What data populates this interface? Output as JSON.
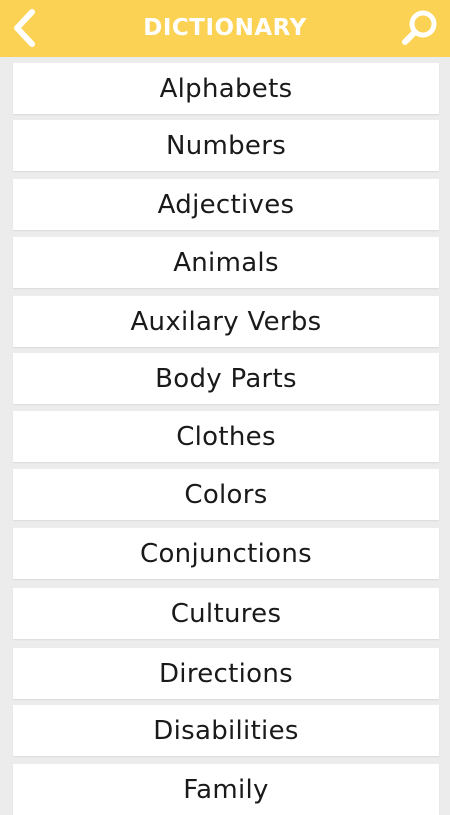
{
  "header": {
    "title": "DICTIONARY",
    "back_icon": "chevron-left-icon",
    "search_icon": "search-icon",
    "bg_color": "#fbd254"
  },
  "categories": [
    {
      "label": "Alphabets"
    },
    {
      "label": "Numbers"
    },
    {
      "label": "Adjectives"
    },
    {
      "label": "Animals"
    },
    {
      "label": "Auxilary Verbs"
    },
    {
      "label": "Body Parts"
    },
    {
      "label": "Clothes"
    },
    {
      "label": "Colors"
    },
    {
      "label": "Conjunctions"
    },
    {
      "label": "Cultures"
    },
    {
      "label": "Directions"
    },
    {
      "label": "Disabilities"
    },
    {
      "label": "Family"
    }
  ]
}
